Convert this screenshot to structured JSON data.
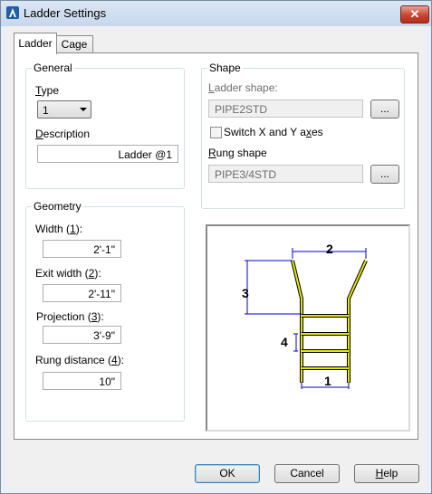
{
  "window": {
    "title": "Ladder Settings",
    "close_icon": "close-icon",
    "app_icon": "autocad-icon"
  },
  "tabs": [
    {
      "label": "Ladder",
      "active": true
    },
    {
      "label": "Cage",
      "active": false
    }
  ],
  "general": {
    "group_title": "General",
    "type_label_first": "T",
    "type_label_rest": "ype",
    "type_value": "1",
    "description_label_first": "D",
    "description_label_rest": "escription",
    "description_value": "Ladder @1"
  },
  "shape": {
    "group_title": "Shape",
    "ladder_shape_label_first": "L",
    "ladder_shape_label_rest": "adder shape:",
    "ladder_shape_value": "PIPE2STD",
    "browse_label": "...",
    "switch_label_before": "Switch X and Y a",
    "switch_label_u": "x",
    "switch_label_after": "es",
    "switch_checked": false,
    "rung_shape_label_first": "R",
    "rung_shape_label_rest": "ung shape",
    "rung_shape_value": "PIPE3/4STD"
  },
  "geometry": {
    "group_title": "Geometry",
    "width_label_before": "Width (",
    "width_label_u": "1",
    "width_label_after": "):",
    "width_value": "2'-1\"",
    "exit_width_label_before": "Exit width (",
    "exit_width_label_u": "2",
    "exit_width_label_after": "):",
    "exit_width_value": "2'-11\"",
    "projection_label_before": "Projection (",
    "projection_label_u": "3",
    "projection_label_after": "):",
    "projection_value": "3'-9\"",
    "rung_distance_label_before": "Rung distance (",
    "rung_distance_label_u": "4",
    "rung_distance_label_after": "):",
    "rung_distance_value": "10\""
  },
  "diagram": {
    "label_1": "1",
    "label_2": "2",
    "label_3": "3",
    "label_4": "4",
    "ladder_color": "#e6e600",
    "dim_color": "#0000cc"
  },
  "buttons": {
    "ok": "OK",
    "cancel": "Cancel",
    "help_first": "H",
    "help_rest": "elp"
  }
}
